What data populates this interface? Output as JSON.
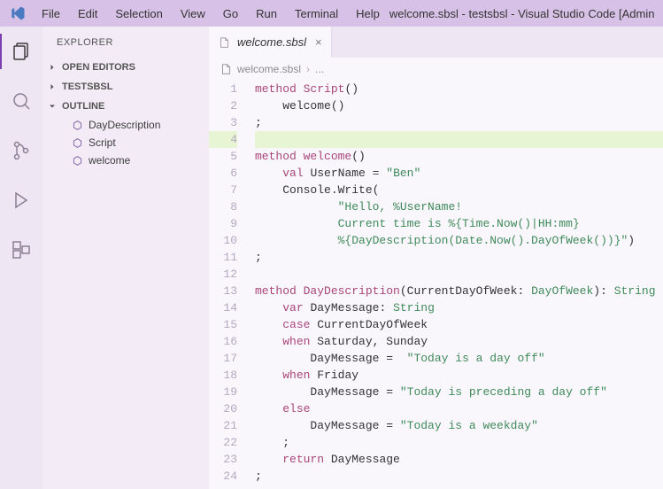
{
  "menubar": {
    "items": [
      "File",
      "Edit",
      "Selection",
      "View",
      "Go",
      "Run",
      "Terminal",
      "Help"
    ],
    "title": "welcome.sbsl - testsbsl - Visual Studio Code [Admin"
  },
  "explorer": {
    "title": "EXPLORER",
    "sections": {
      "open_editors": "OPEN EDITORS",
      "project": "TESTSBSL",
      "outline": "OUTLINE"
    },
    "outline_items": [
      "DayDescription",
      "Script",
      "welcome"
    ]
  },
  "tabs": [
    {
      "label": "welcome.sbsl",
      "active": true
    }
  ],
  "breadcrumbs": {
    "file": "welcome.sbsl",
    "rest": "..."
  },
  "code": {
    "line_count": 24,
    "highlighted_line": 4,
    "tokens": {
      "method": "method",
      "val": "val",
      "var": "var",
      "case": "case",
      "when": "when",
      "else": "else",
      "return": "return",
      "Script": "Script",
      "welcome": "welcome",
      "welcome_call": "welcome()",
      "UserName": "UserName",
      "Ben": "\"Ben\"",
      "ConsoleWrite": "Console.Write(",
      "str1": "\"Hello, %UserName!",
      "str2": "Current time is %{Time.Now()|HH:mm}",
      "str3": "%{DayDescription(Date.Now().DayOfWeek())}\"",
      "DayDescription": "DayDescription",
      "sig_params": "(CurrentDayOfWeek: ",
      "DayOfWeek": "DayOfWeek",
      "sig_end": "): ",
      "String": "String",
      "DayMessage": "DayMessage",
      "colon_sp": ": ",
      "CurrentDayOfWeek": "CurrentDayOfWeek",
      "SatSun": "Saturday, Sunday",
      "eq": " =  ",
      "eq2": " = ",
      "today_off": "\"Today is a day off\"",
      "Friday": "Friday",
      "today_preceding": "\"Today is preceding a day off\"",
      "today_weekday": "\"Today is a weekday\"",
      "semicolon": ";",
      "parens": "()",
      "close_paren": ")",
      "space": " "
    }
  }
}
